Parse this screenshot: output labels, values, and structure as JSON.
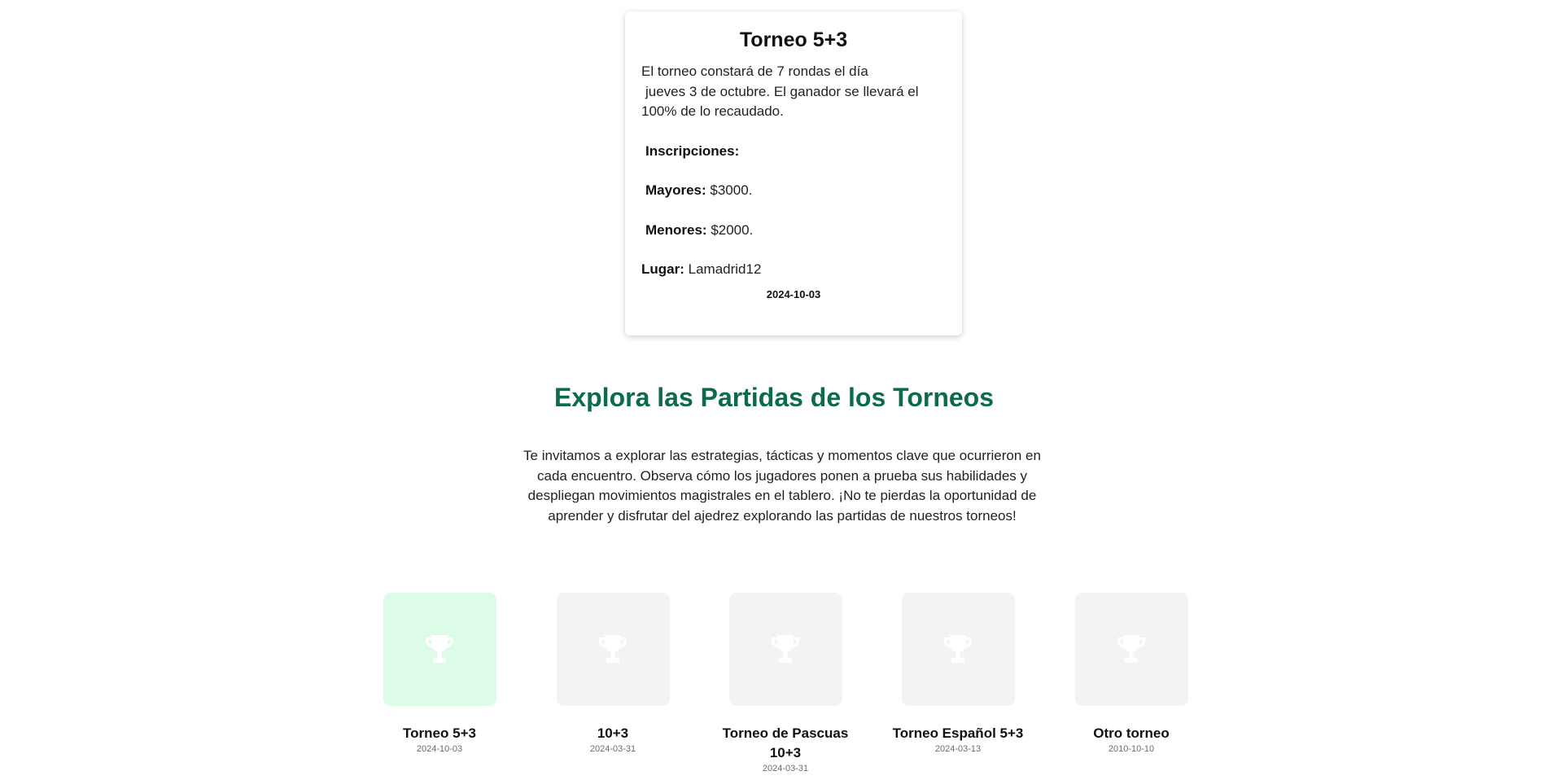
{
  "card": {
    "title": "Torneo 5+3",
    "description_1": "El torneo constará de 7 rondas el día",
    "description_2": "jueves 3 de octubre. El ganador se llevará el 100% de lo recaudado.",
    "registration_label": "Inscripciones:",
    "adults_label": "Mayores:",
    "adults_value": "$3000.",
    "minors_label": "Menores:",
    "minors_value": "$2000.",
    "place_label": "Lugar:",
    "place_value": "Lamadrid12",
    "date": "2024-10-03"
  },
  "section": {
    "title": "Explora las Partidas de los Torneos",
    "text": "Te invitamos a explorar las estrategias, tácticas y momentos clave que ocurrieron en cada encuentro. Observa cómo los jugadores ponen a prueba sus habilidades y despliegan movimientos magistrales en el tablero. ¡No te pierdas la oportunidad de aprender y disfrutar del ajedrez explorando las partidas de nuestros torneos!"
  },
  "colors": {
    "accent": "#0e6b4a",
    "active_tile": "#dcfce7",
    "tile": "#f2f3f4",
    "icon": "#ffffff"
  },
  "tournaments": [
    {
      "name": "Torneo 5+3",
      "date": "2024-10-03",
      "icon": "trophy-icon",
      "active": true
    },
    {
      "name": "10+3",
      "date": "2024-03-31",
      "icon": "trophy-icon",
      "active": false
    },
    {
      "name": "Torneo de Pascuas 10+3",
      "date": "2024-03-31",
      "icon": "trophy-icon",
      "active": false
    },
    {
      "name": "Torneo Español 5+3",
      "date": "2024-03-13",
      "icon": "trophy-icon",
      "active": false
    },
    {
      "name": "Otro torneo",
      "date": "2010-10-10",
      "icon": "trophy-icon",
      "active": false
    }
  ]
}
